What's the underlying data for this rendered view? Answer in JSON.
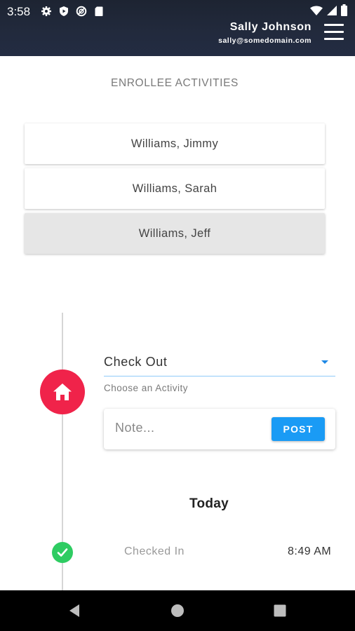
{
  "status_bar": {
    "time": "3:58",
    "icons": [
      "gear-icon",
      "play-protect-icon",
      "data-saver-icon",
      "sd-card-icon"
    ],
    "right_icons": [
      "wifi-icon",
      "signal-icon",
      "battery-icon"
    ]
  },
  "header": {
    "user_name": "Sally Johnson",
    "user_email": "sally@somedomain.com",
    "menu_icon": "hamburger-menu-icon"
  },
  "section_title": "ENROLLEE ACTIVITIES",
  "enrollees": [
    {
      "name": "Williams, Jimmy",
      "selected": false
    },
    {
      "name": "Williams, Sarah",
      "selected": false
    },
    {
      "name": "Williams, Jeff",
      "selected": true
    }
  ],
  "activity": {
    "icon": "home-icon",
    "selected": "Check Out",
    "helper_text": "Choose an Activity"
  },
  "note": {
    "placeholder": "Note...",
    "post_label": "POST"
  },
  "timeline": {
    "day_label": "Today",
    "entries": [
      {
        "label": "Checked In",
        "time": "8:49 AM",
        "icon": "check-circle-icon"
      }
    ]
  },
  "colors": {
    "header_bg": "#1d2432",
    "accent_red": "#f0234a",
    "post_blue": "#1a9bf5",
    "check_green": "#2ecc62"
  }
}
